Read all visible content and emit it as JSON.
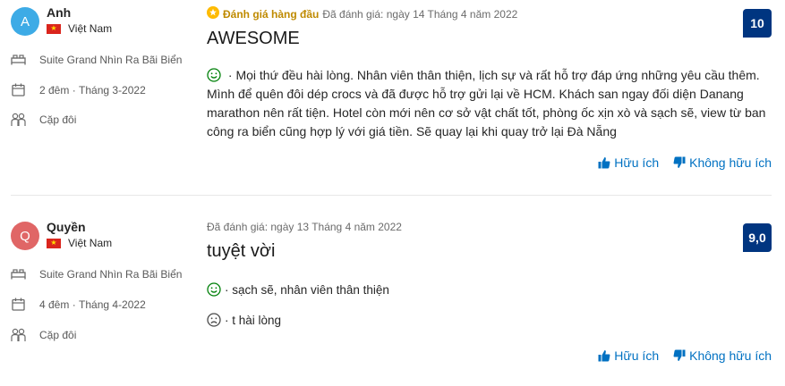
{
  "reviews": [
    {
      "avatar_letter": "A",
      "avatar_color": "#3dabe6",
      "name": "Anh",
      "country": "Việt Nam",
      "room": "Suite Grand Nhìn Ra Bãi Biển",
      "nights": "2 đêm",
      "stay_month": "Tháng 3-2022",
      "traveler_type": "Cặp đôi",
      "top_badge": "Đánh giá hàng đầu",
      "review_date": "Đã đánh giá: ngày 14 Tháng 4 năm 2022",
      "title": "AWESOME",
      "positive": "· Mọi thứ đều hài lòng. Nhân viên thân thiện, lịch sự và rất hỗ trợ đáp ứng những yêu cầu thêm. Mình để quên đôi dép crocs và đã được hỗ trợ gửi lại về HCM. Khách san ngay đối diện Danang marathon nên rất tiện. Hotel còn mới nên cơ sở vật chất tốt, phòng ốc xịn xò và sạch sẽ, view từ ban công ra biển cũng hợp lý với giá tiền. Sẽ quay lại khi quay trở lại Đà Nẵng",
      "score": "10",
      "helpful": "Hữu ích",
      "not_helpful": "Không hữu ích"
    },
    {
      "avatar_letter": "Q",
      "avatar_color": "#e06666",
      "name": "Quyền",
      "country": "Việt Nam",
      "room": "Suite Grand Nhìn Ra Bãi Biển",
      "nights": "4 đêm",
      "stay_month": "Tháng 4-2022",
      "traveler_type": "Cặp đôi",
      "review_date": "Đã đánh giá: ngày 13 Tháng 4 năm 2022",
      "title": "tuyệt vời",
      "positive": "· sạch sẽ, nhân viên thân thiện",
      "negative": "· t hài lòng",
      "score": "9,0",
      "helpful": "Hữu ích",
      "not_helpful": "Không hữu ích"
    }
  ],
  "colors": {
    "score_bg": "#003580",
    "link": "#0071c2",
    "positive_face": "#008009",
    "badge": "#febb02"
  },
  "icons": [
    "bed-icon",
    "calendar-icon",
    "people-icon",
    "smile-icon",
    "frown-icon",
    "thumbs-up-icon",
    "thumbs-down-icon",
    "star-badge-icon"
  ]
}
